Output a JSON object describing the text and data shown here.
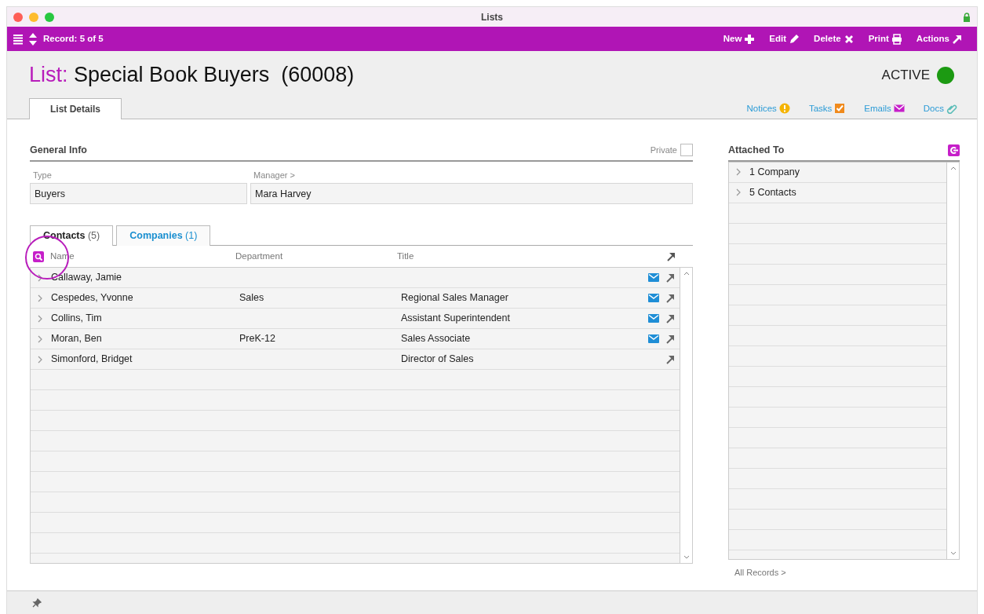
{
  "window": {
    "title": "Lists"
  },
  "toolbar": {
    "record": "Record: 5 of 5",
    "actions": [
      {
        "label": "New",
        "kind": "new"
      },
      {
        "label": "Edit",
        "kind": "edit"
      },
      {
        "label": "Delete",
        "kind": "delete"
      },
      {
        "label": "Print",
        "kind": "print"
      },
      {
        "label": "Actions",
        "kind": "actions"
      }
    ]
  },
  "header": {
    "prefix": "List:",
    "title": "Special Book Buyers  (60008)",
    "status": "ACTIVE",
    "active": true
  },
  "tabs": [
    {
      "label": "List Details",
      "selected": true
    }
  ],
  "links": [
    {
      "label": "Notices",
      "kind": "notices"
    },
    {
      "label": "Tasks",
      "kind": "tasks"
    },
    {
      "label": "Emails",
      "kind": "emails"
    },
    {
      "label": "Docs",
      "kind": "docs"
    }
  ],
  "general_info": {
    "heading": "General Info",
    "private_label": "Private",
    "private": false,
    "fields": [
      {
        "label": "Type",
        "value": "Buyers"
      },
      {
        "label": "Manager >",
        "value": "Mara Harvey"
      }
    ]
  },
  "subtabs": [
    {
      "label": "Contacts",
      "count": "(5)",
      "selected": true
    },
    {
      "label": "Companies",
      "count": "(1)",
      "selected": false
    }
  ],
  "contacts": {
    "columns": [
      "Name",
      "Department",
      "Title"
    ],
    "rows": [
      {
        "name": "Callaway, Jamie",
        "department": "",
        "title": "",
        "email": true
      },
      {
        "name": "Cespedes, Yvonne",
        "department": "Sales",
        "title": "Regional Sales Manager",
        "email": true
      },
      {
        "name": "Collins, Tim",
        "department": "",
        "title": "Assistant Superintendent",
        "email": true
      },
      {
        "name": "Moran, Ben",
        "department": "PreK-12",
        "title": "Sales Associate",
        "email": true
      },
      {
        "name": "Simonford, Bridget",
        "department": "",
        "title": "Director of Sales",
        "email": false
      }
    ]
  },
  "attached": {
    "heading": "Attached To",
    "items": [
      "1 Company",
      "5 Contacts"
    ],
    "footer_link": "All Records >"
  }
}
